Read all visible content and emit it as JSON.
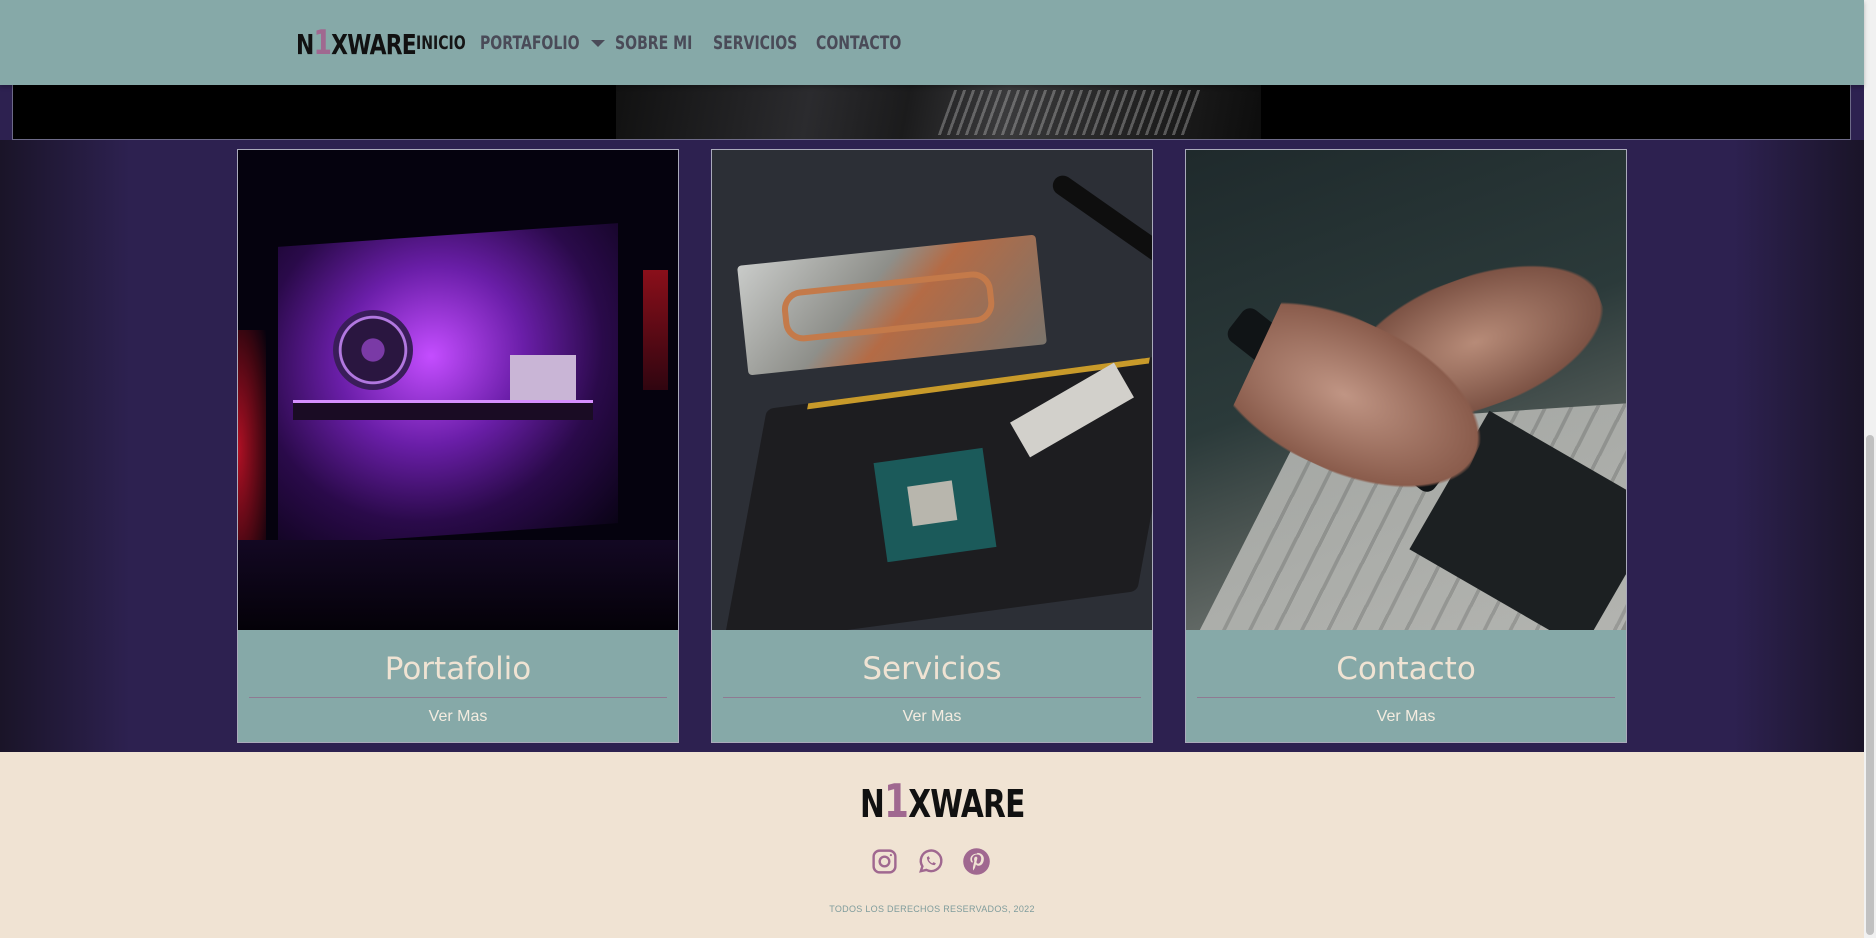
{
  "navbar": {
    "brand": {
      "prefix": "N",
      "accent": "1",
      "suffix": "XWARE"
    },
    "items": [
      {
        "label": "INICIO",
        "active": true
      },
      {
        "label": "PORTAFOLIO",
        "dropdown": true
      },
      {
        "label": "SOBRE MI"
      },
      {
        "label": "SERVICIOS"
      },
      {
        "label": "CONTACTO"
      }
    ]
  },
  "cards": [
    {
      "title": "Portafolio",
      "link": "Ver Mas",
      "image": "gaming-pc-photo"
    },
    {
      "title": "Servicios",
      "link": "Ver Mas",
      "image": "graphics-card-repair-photo"
    },
    {
      "title": "Contacto",
      "link": "Ver Mas",
      "image": "hands-smartphone-photo"
    }
  ],
  "footer": {
    "brand": {
      "prefix": "N",
      "accent": "1",
      "suffix": "XWARE"
    },
    "social": [
      "instagram-icon",
      "whatsapp-icon",
      "pinterest-icon"
    ],
    "copyright": "TODOS LOS DERECHOS RESERVADOS, 2022"
  },
  "colors": {
    "navbar": "#86a9a8",
    "page_background": "#2d2150",
    "footer_background": "#f0e3d3",
    "accent": "#a06890",
    "card_title": "#f0e3d3"
  }
}
